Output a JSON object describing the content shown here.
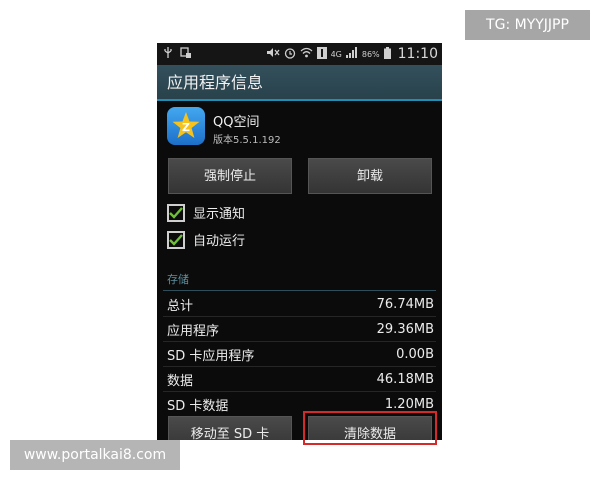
{
  "status_bar": {
    "network_tag": "4G",
    "battery": "86%",
    "time": "11:10",
    "icons": [
      "usb-icon",
      "debug-icon",
      "mute-icon",
      "alarm-icon",
      "wifi-icon",
      "notification-icon",
      "signal-icon",
      "battery-icon"
    ]
  },
  "header": {
    "title": "应用程序信息"
  },
  "app": {
    "name": "QQ空间",
    "version": "版本5.5.1.192",
    "icon": "qzone-star-icon",
    "icon_letter": "Z"
  },
  "buttons": {
    "force_stop": "强制停止",
    "uninstall": "卸载",
    "move_to_sd": "移动至 SD 卡",
    "clear_data": "清除数据"
  },
  "checks": [
    {
      "label": "显示通知",
      "checked": true
    },
    {
      "label": "自动运行",
      "checked": true
    }
  ],
  "storage": {
    "header": "存储",
    "rows": [
      {
        "label": "总计",
        "value": "76.74MB"
      },
      {
        "label": "应用程序",
        "value": "29.36MB"
      },
      {
        "label": "SD 卡应用程序",
        "value": "0.00B"
      },
      {
        "label": "数据",
        "value": "46.18MB"
      },
      {
        "label": "SD 卡数据",
        "value": "1.20MB"
      }
    ]
  },
  "watermarks": {
    "tg": "TG: MYYJJPP",
    "site": "www.portalkai8.com"
  },
  "colors": {
    "accent": "#1f8fb3",
    "highlight": "#d42a2a",
    "check": "#6fbf3a"
  }
}
